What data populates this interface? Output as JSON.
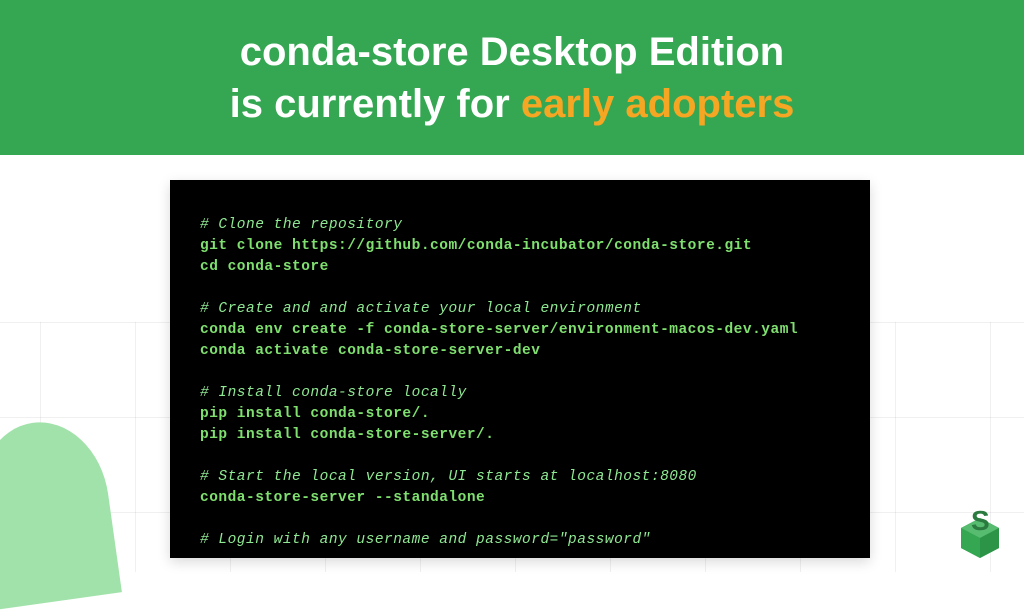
{
  "header": {
    "line1_prefix": "conda-store Desktop Edition",
    "line2_prefix": "is currently for ",
    "line2_highlight": "early adopters"
  },
  "terminal": {
    "blocks": [
      {
        "type": "comment",
        "text": "# Clone the repository"
      },
      {
        "type": "command",
        "text": "git clone https://github.com/conda-incubator/conda-store.git"
      },
      {
        "type": "command",
        "text": "cd conda-store"
      },
      {
        "type": "blank"
      },
      {
        "type": "comment",
        "text": "# Create and and activate your local environment"
      },
      {
        "type": "command",
        "text": "conda env create -f conda-store-server/environment-macos-dev.yaml"
      },
      {
        "type": "command",
        "text": "conda activate conda-store-server-dev"
      },
      {
        "type": "blank"
      },
      {
        "type": "comment",
        "text": "# Install conda-store locally"
      },
      {
        "type": "command",
        "text": "pip install conda-store/."
      },
      {
        "type": "command",
        "text": "pip install conda-store-server/."
      },
      {
        "type": "blank"
      },
      {
        "type": "comment",
        "text": "# Start the local version, UI starts at localhost:8080"
      },
      {
        "type": "command",
        "text": "conda-store-server --standalone"
      },
      {
        "type": "blank"
      },
      {
        "type": "comment",
        "text": "# Login with any username and password=\"password\""
      }
    ]
  },
  "logo": {
    "letter": "S"
  }
}
